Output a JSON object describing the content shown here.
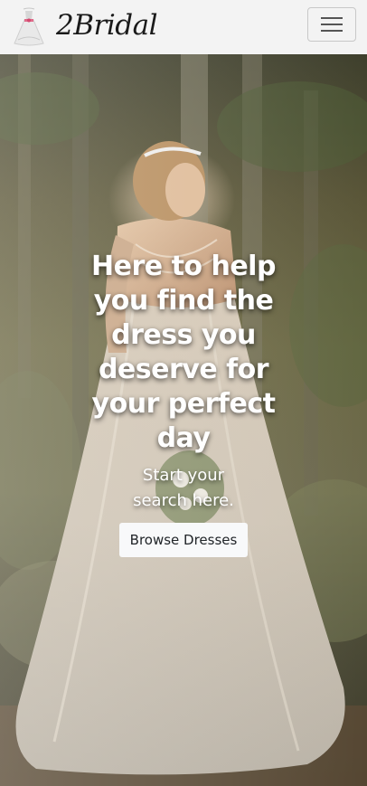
{
  "navbar": {
    "brand_name": "2Bridal",
    "logo_icon": "wedding-dress-icon",
    "menu_icon": "hamburger-menu-icon"
  },
  "hero": {
    "headline": "Here to help you find the dress you deserve for your perfect day",
    "subtitle": "Start your search here.",
    "cta_label": "Browse Dresses",
    "background_description_icon": "bride-in-forest-photo"
  },
  "colors": {
    "navbar_bg": "#f3f3f3",
    "cta_bg": "#f8f9fa",
    "text_light": "#ffffff"
  }
}
